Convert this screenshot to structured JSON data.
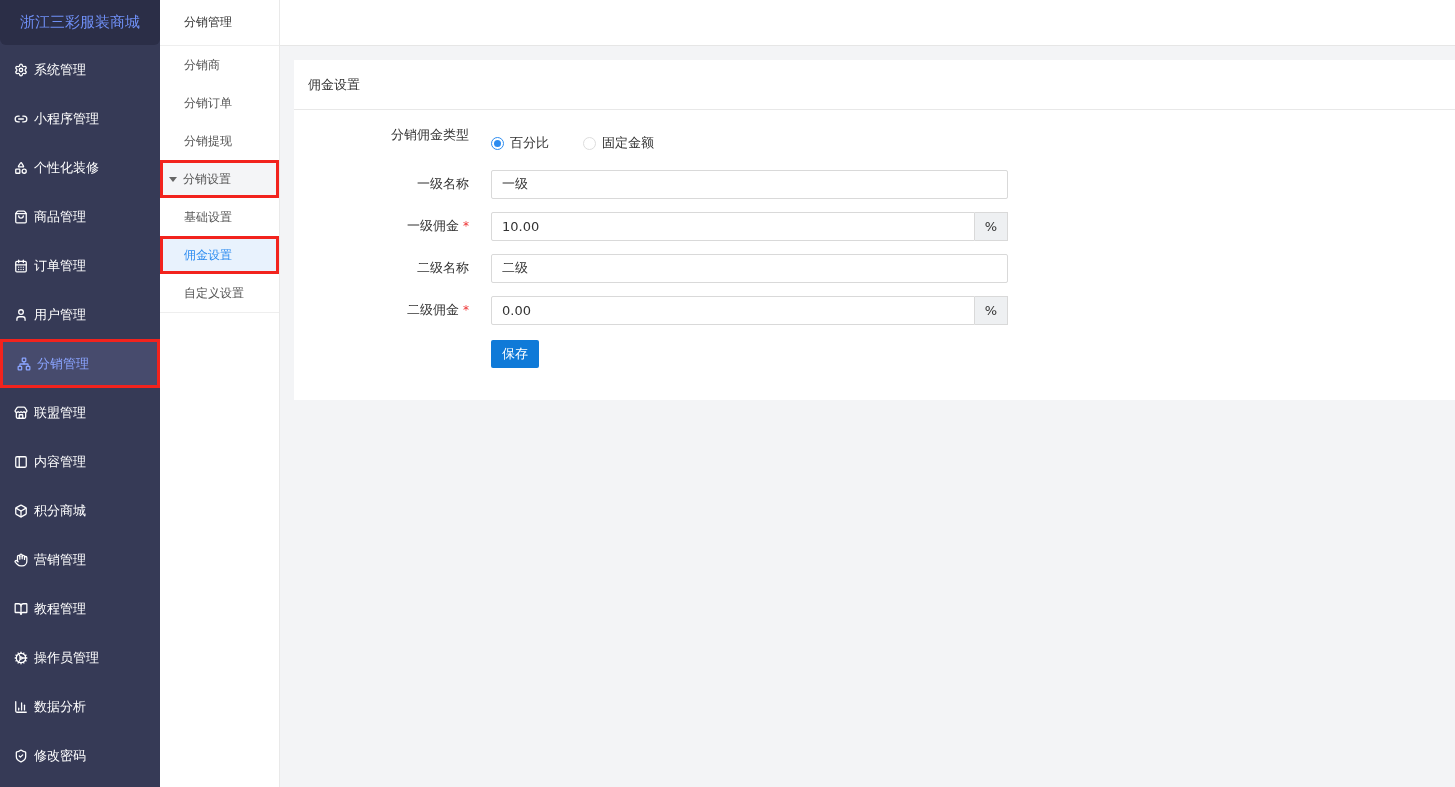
{
  "brand": "浙江三彩服装商城",
  "sidebar": {
    "items": [
      {
        "label": "系统管理",
        "selected": false,
        "annotated": false
      },
      {
        "label": "小程序管理",
        "selected": false,
        "annotated": false
      },
      {
        "label": "个性化装修",
        "selected": false,
        "annotated": false
      },
      {
        "label": "商品管理",
        "selected": false,
        "annotated": false
      },
      {
        "label": "订单管理",
        "selected": false,
        "annotated": false
      },
      {
        "label": "用户管理",
        "selected": false,
        "annotated": false
      },
      {
        "label": "分销管理",
        "selected": true,
        "annotated": true
      },
      {
        "label": "联盟管理",
        "selected": false,
        "annotated": false
      },
      {
        "label": "内容管理",
        "selected": false,
        "annotated": false
      },
      {
        "label": "积分商城",
        "selected": false,
        "annotated": false
      },
      {
        "label": "营销管理",
        "selected": false,
        "annotated": false
      },
      {
        "label": "教程管理",
        "selected": false,
        "annotated": false
      },
      {
        "label": "操作员管理",
        "selected": false,
        "annotated": false
      },
      {
        "label": "数据分析",
        "selected": false,
        "annotated": false
      },
      {
        "label": "修改密码",
        "selected": false,
        "annotated": false
      }
    ]
  },
  "submenu": {
    "title": "分销管理",
    "items": [
      {
        "label": "分销商",
        "selected": false,
        "annotated": false
      },
      {
        "label": "分销订单",
        "selected": false,
        "annotated": false
      },
      {
        "label": "分销提现",
        "selected": false,
        "annotated": false
      },
      {
        "label": "分销设置",
        "selected": false,
        "annotated": true,
        "expanded": true,
        "children": [
          {
            "label": "基础设置",
            "selected": false,
            "annotated": false
          },
          {
            "label": "佣金设置",
            "selected": true,
            "annotated": true
          }
        ]
      },
      {
        "label": "自定义设置",
        "selected": false,
        "annotated": false
      }
    ]
  },
  "card": {
    "title": "佣金设置",
    "fields": [
      {
        "kind": "radio",
        "label": "分销佣金类型",
        "options": [
          {
            "label": "百分比",
            "selected": true
          },
          {
            "label": "固定金额",
            "selected": false
          }
        ]
      },
      {
        "kind": "text",
        "label": "一级名称",
        "value": "一级"
      },
      {
        "kind": "addon",
        "label": "一级佣金",
        "required_mark": "*",
        "value": "10.00",
        "addon": "%"
      },
      {
        "kind": "text",
        "label": "二级名称",
        "value": "二级"
      },
      {
        "kind": "addon",
        "label": "二级佣金",
        "required_mark": "*",
        "value": "0.00",
        "addon": "%"
      }
    ],
    "save_button": "保存"
  }
}
